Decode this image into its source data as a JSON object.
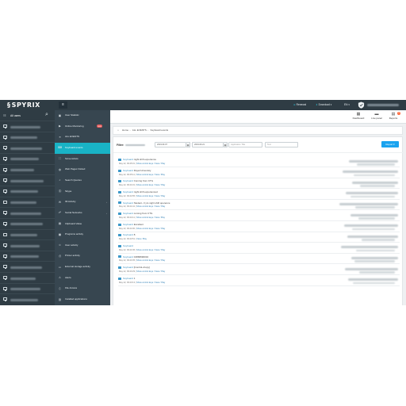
{
  "colors": {
    "topbar": "#2f3c44",
    "nav_bg": "#374650",
    "accent": "#19b3c6",
    "new_badge": "#e35a5a",
    "report_button": "#1aa3ef",
    "link": "#2f7fb5"
  },
  "topbar": {
    "logo_text": "SPYRIX",
    "logo_icon": "spyrix-s-logo",
    "menu_icon": "hamburger-icon",
    "renewal_label": "Renewal",
    "download_label": "Download",
    "language_label": "EN",
    "shield_icon": "shield-check-icon"
  },
  "users_panel": {
    "all_users_label": "All users",
    "user_row_count": 17
  },
  "nav": [
    {
      "label": "User Statistic",
      "icon": "stats-icon",
      "symbol": "▣"
    },
    {
      "label": "Online Monitoring",
      "icon": "play-icon",
      "symbol": "▶",
      "badge": "new"
    },
    {
      "label": "ALL EVENTS",
      "icon": "list-icon",
      "symbol": "≡"
    },
    {
      "label": "Keyboard events",
      "icon": "keyboard-icon",
      "symbol": "⌨",
      "active": true
    },
    {
      "label": "Screenshots",
      "icon": "screenshot-icon",
      "symbol": "⛶"
    },
    {
      "label": "Web Pages Visited",
      "icon": "globe-icon",
      "symbol": "◍"
    },
    {
      "label": "Search Queries",
      "icon": "search-icon",
      "symbol": "⌕"
    },
    {
      "label": "Skype",
      "icon": "skype-icon",
      "symbol": "Ⓢ"
    },
    {
      "label": "IM Activity",
      "icon": "chat-icon",
      "symbol": "✉",
      "arrow": true
    },
    {
      "label": "Social Networks",
      "icon": "social-icon",
      "symbol": "☍",
      "arrow": true
    },
    {
      "label": "Clipboard Value",
      "icon": "clipboard-icon",
      "symbol": "▤"
    },
    {
      "label": "Programs activity",
      "icon": "programs-icon",
      "symbol": "▦"
    },
    {
      "label": "User activity",
      "icon": "user-icon",
      "symbol": "☺"
    },
    {
      "label": "Printer activity",
      "icon": "printer-icon",
      "symbol": "⎙"
    },
    {
      "label": "External storage activity",
      "icon": "usb-icon",
      "symbol": "▭"
    },
    {
      "label": "Alerts",
      "icon": "alert-icon",
      "symbol": "⚠"
    },
    {
      "label": "File Access",
      "icon": "file-icon",
      "symbol": "▯"
    },
    {
      "label": "Installed applications",
      "icon": "apps-icon",
      "symbol": "▥"
    }
  ],
  "reports_bar": {
    "dashboard_label": "Dashboard",
    "live_label": "Live panel",
    "reports_label": "Reports",
    "reports_badge": "0"
  },
  "breadcrumb": {
    "home": "Home",
    "all_events": "ALL EVENTS",
    "current": "Keyboard events"
  },
  "filter": {
    "label": "Filter:",
    "date_from": "2019.09.07",
    "date_to": "2019.09.21",
    "app_placeholder": "Application Title",
    "text_placeholder": "Text",
    "report_button": "Report ▾"
  },
  "events": [
    {
      "type": "Keyboard",
      "text": "night shift experience",
      "time": "May 22, 09:45:01",
      "links": "Show control keys / View / Play"
    },
    {
      "type": "Keyboard",
      "text": "Royal University",
      "time": "May 22, 09:45:11",
      "links": "Show control keys / View / Play"
    },
    {
      "type": "Keyboard",
      "text": "Coming from CTG",
      "time": "May 22, 09:44:31",
      "links": "Show control keys / View / Play"
    },
    {
      "type": "Keyboard",
      "text": "night shift experienced",
      "time": "May 22, 09:44:55",
      "links": "Show control keys / View / Play"
    },
    {
      "type": "Keyboard",
      "text": "Student- 3 yrs night shift operence",
      "time": "May 22, 09:44:41",
      "links": "Show control keys / View / Play"
    },
    {
      "type": "Keyboard",
      "text": "coming from CTG",
      "time": "May 22, 09:44:11",
      "links": "Show control keys / View / Play"
    },
    {
      "type": "Keyboard",
      "text": "Excellent",
      "time": "May 22, 09:44:00",
      "links": "Show control keys / View / Play"
    },
    {
      "type": "Keyboard",
      "text": "8",
      "time": "May 22, 09:43:51",
      "links": "View / Play"
    },
    {
      "type": "Keyboard",
      "text": "",
      "time": "May 22, 09:43:45",
      "links": "Show control keys / View / Play"
    },
    {
      "type": "Keyboard",
      "text": "01868990034",
      "time": "May 22, 09:43:35",
      "links": "Show control keys / View / Play"
    },
    {
      "type": "Keyboard",
      "text": "[Control+Copy]",
      "time": "May 22, 09:43:29",
      "links": "Show control keys / View / Play"
    },
    {
      "type": "Keyboard",
      "text": "1",
      "time": "May 22, 09:43:13",
      "links": "Show control keys / View / Play"
    }
  ]
}
